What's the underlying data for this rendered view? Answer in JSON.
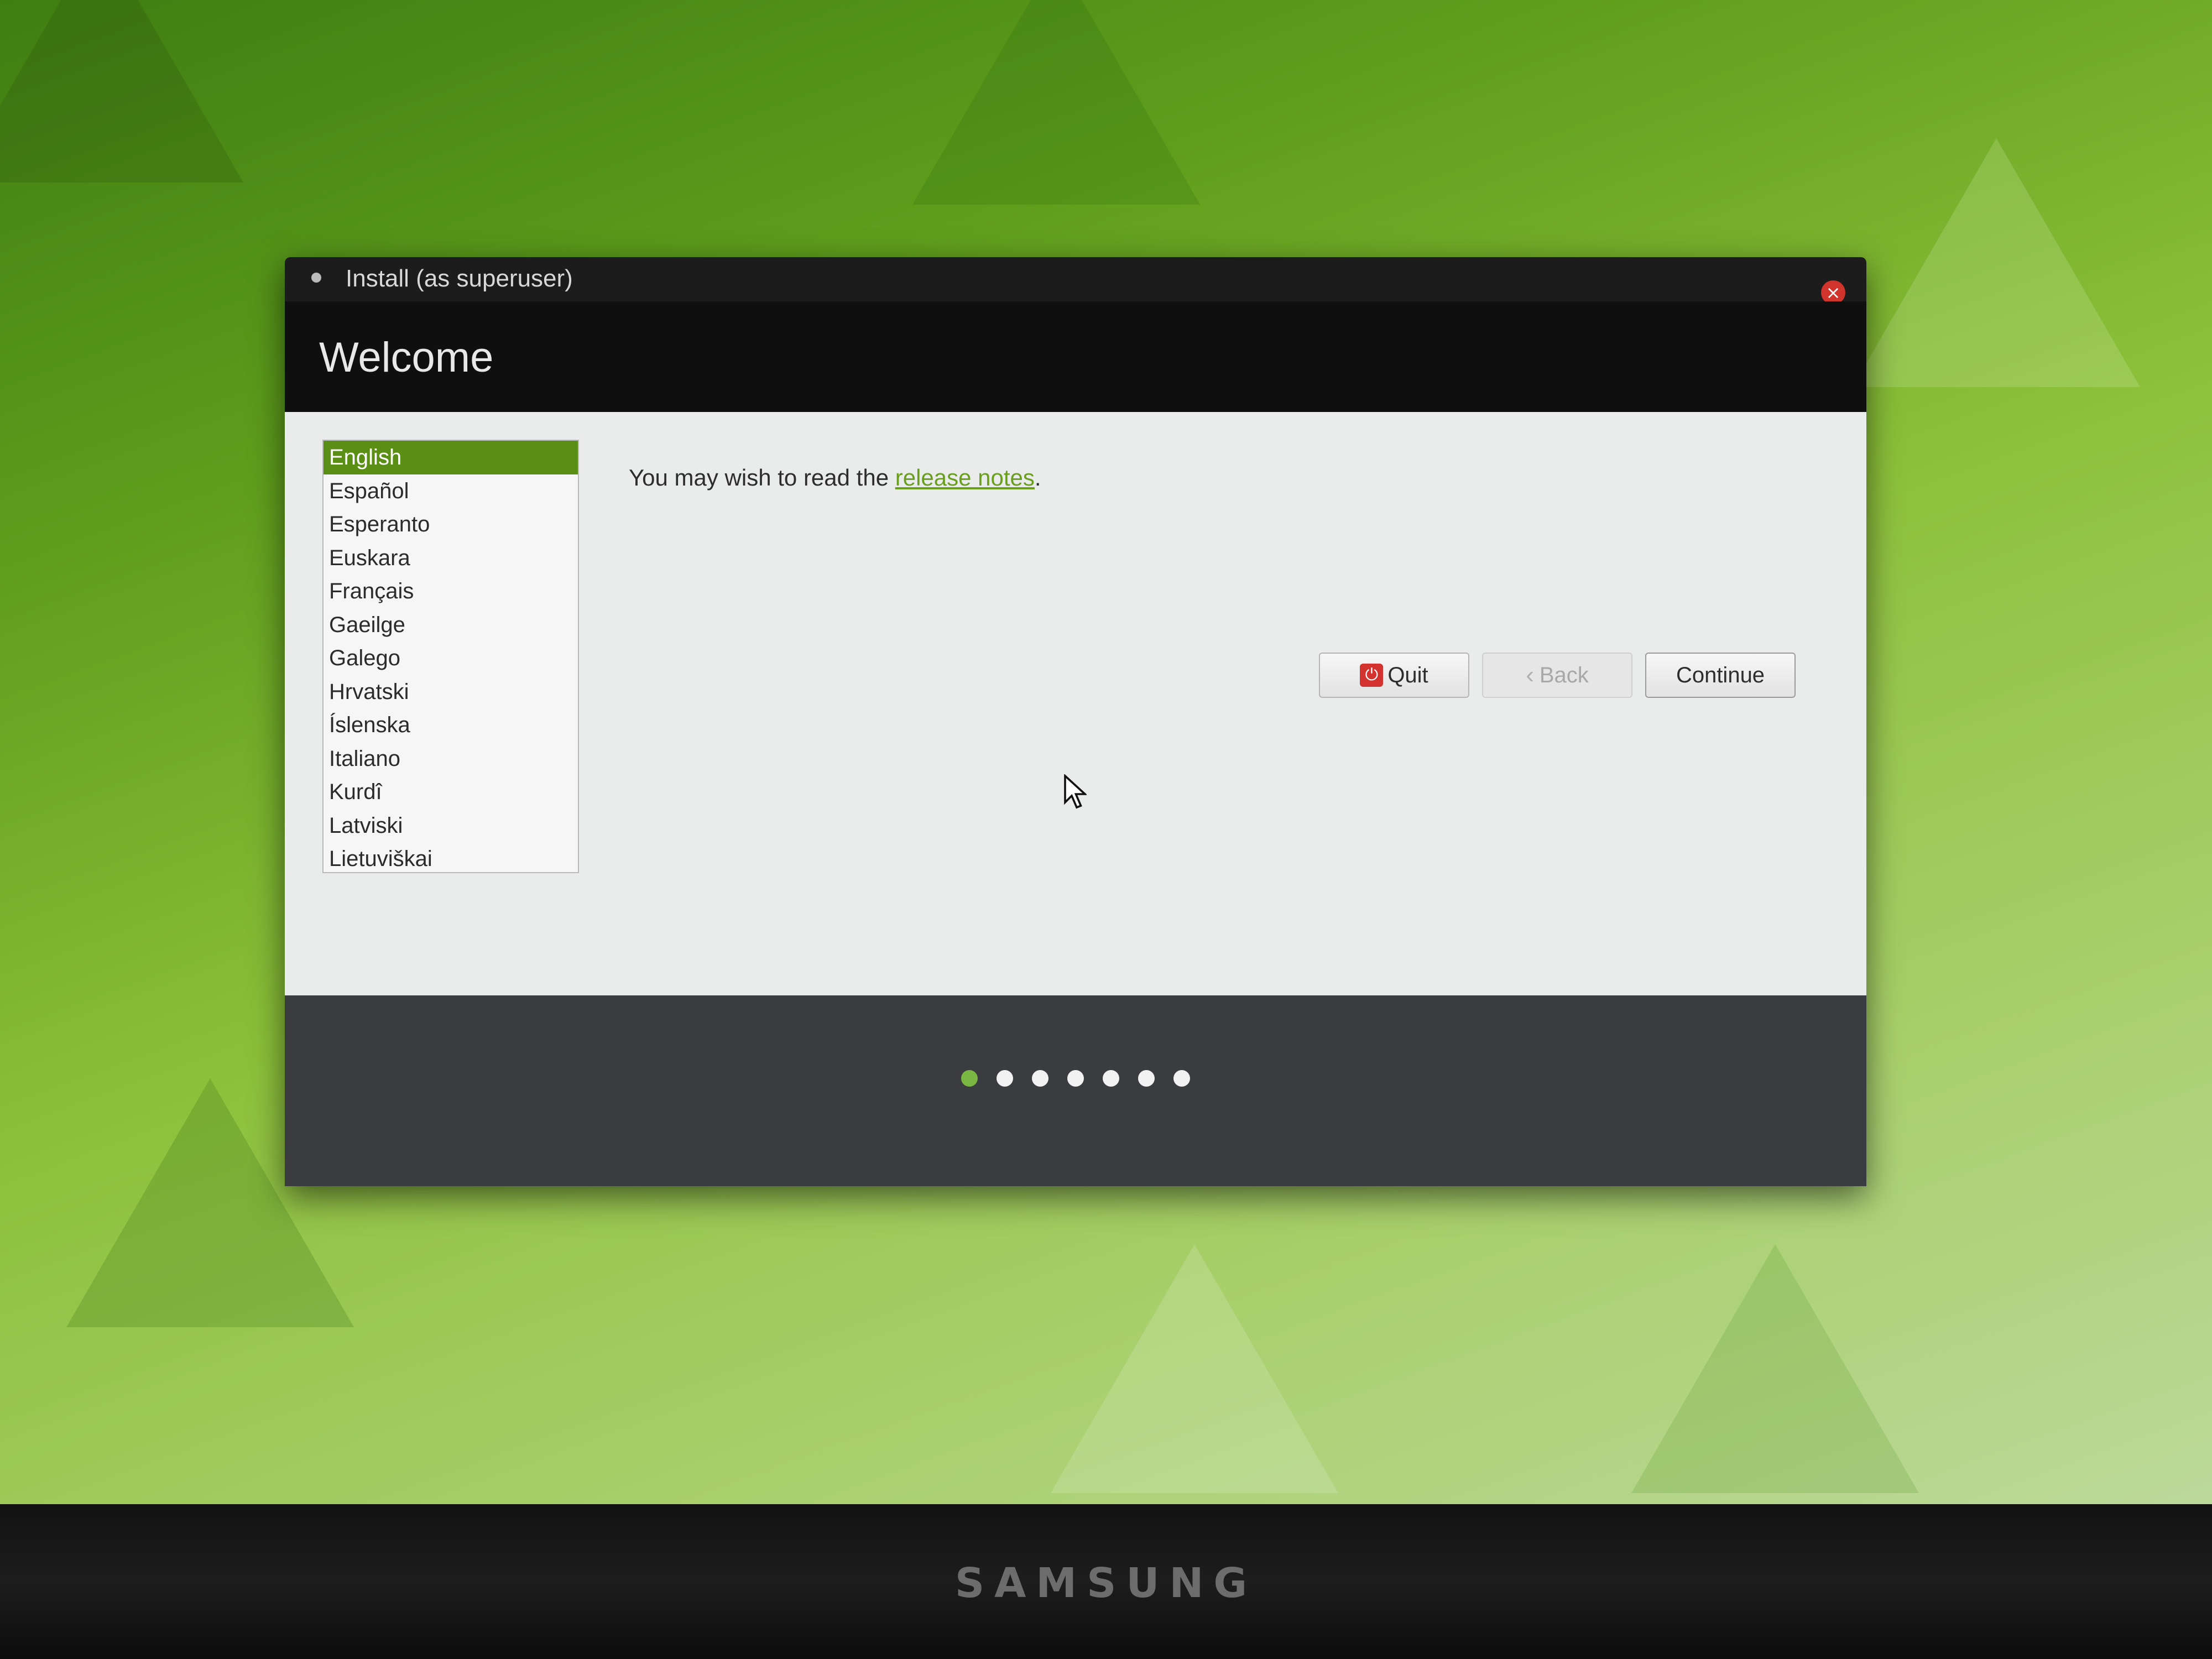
{
  "window": {
    "title": "Install (as superuser)",
    "close_glyph": "×"
  },
  "header": {
    "title": "Welcome"
  },
  "languages": [
    "English",
    "Español",
    "Esperanto",
    "Euskara",
    "Français",
    "Gaeilge",
    "Galego",
    "Hrvatski",
    "Íslenska",
    "Italiano",
    "Kurdî",
    "Latviski",
    "Lietuviškai"
  ],
  "selected_language_index": 0,
  "release_notes": {
    "prefix": "You may wish to read the ",
    "link_text": "release notes",
    "suffix": "."
  },
  "buttons": {
    "quit": "Quit",
    "back": "Back",
    "continue": "Continue"
  },
  "progress": {
    "total_steps": 7,
    "current_step": 1
  },
  "monitor": {
    "brand": "SAMSUNG"
  },
  "colors": {
    "accent": "#5a8e15",
    "link": "#6a9e1f",
    "active_dot": "#79b642",
    "close": "#d0342c"
  }
}
